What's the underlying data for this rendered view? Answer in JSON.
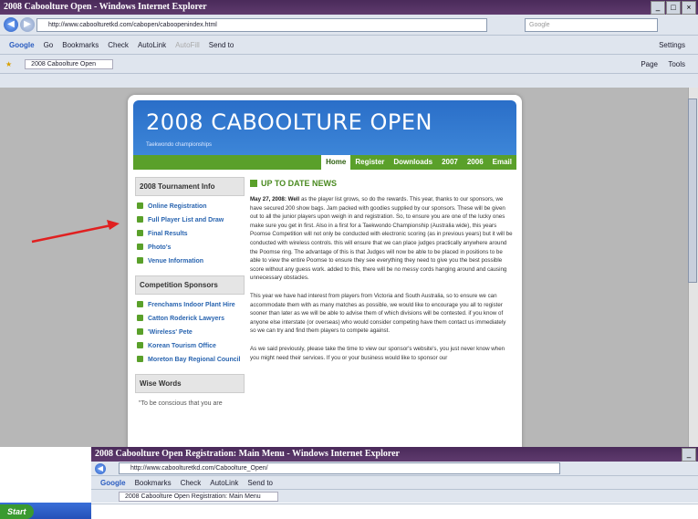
{
  "browser1": {
    "title": "2008 Caboolture Open - Windows Internet Explorer",
    "url": "http://www.caboolturetkd.com/cabopen/caboopenindex.html",
    "search_placeholder": "Google",
    "toolbar": [
      "Go",
      "Bookmarks",
      "Check",
      "AutoLink",
      "AutoFill",
      "Send to"
    ],
    "settings": "Settings",
    "tab_title": "2008 Caboolture Open",
    "cmd": [
      "Page",
      "Tools"
    ]
  },
  "site": {
    "title": "2008 CABOOLTURE OPEN",
    "subtitle": "Taekwondo championships",
    "nav": [
      "Home",
      "Register",
      "Downloads",
      "2007",
      "2006",
      "Email"
    ],
    "sidebar": {
      "heading1": "2008 Tournament Info",
      "links1": [
        "Online Registration",
        "Full Player List and Draw",
        "Final Results",
        "Photo's",
        "Venue Information"
      ],
      "heading2": "Competition Sponsors",
      "links2": [
        "Frenchams Indoor Plant Hire",
        "Catton Roderick Lawyers",
        "'Wireless' Pete",
        "Korean Tourism Office",
        "Moreton Bay Regional Council"
      ],
      "heading3": "Wise Words",
      "quote": "\"To be conscious that you are"
    },
    "news_heading": "UP TO DATE NEWS",
    "news_date": "May 27, 2008: Well",
    "news_p1": "as the player list grows, so do the rewards. This year, thanks to our sponsors, we have secured 200 show bags. Jam packed with goodies supplied by our sponsors. These will be given out to all the junior players upon weigh in and registration. So, to ensure you are one of the lucky ones make sure you get in first. Also in a first for a Taekwondo Championship (Australia wide), this years Poomse Competition will not only be conducted with electronic scoring (as in previous years) but it will be conducted with wireless controls. this will ensure that we can place judges practically anywhere around the Poomse ring. The advantage of this is that Judges will now be able to be placed in positions to be able to view the entire Poomse to ensure they see everything they need to give you the best possible score without any guess work. added to this, there will be no messy cords hanging around and causing unnecessary obstacles.",
    "news_p2": "This year we have had interest from players from Victoria and South Australia, so to ensure we can accommodate them with as many matches as possible, we would like to encourage you all to register sooner than later as we will be able to advise them of which divisions will be contested. if you know of anyone else interstate (or overseas) who would consider competing have them contact us immediately so we can try and find them players to compete against.",
    "news_p3": "As we said previously, please take the time to view our sponsor's website's, you just never know when you might need their services. If you or your business would like to sponsor our"
  },
  "browser2": {
    "title": "2008 Caboolture Open Registration: Main Menu - Windows Internet Explorer",
    "url": "http://www.caboolturetkd.com/Caboolture_Open/",
    "tab_title": "2008 Caboolture Open Registration: Main Menu"
  },
  "taskbar": {
    "start": "Start"
  },
  "colors": {
    "accent_red": "#e02020",
    "nav_green": "#5aa02a",
    "banner_blue": "#2a6ec8"
  }
}
